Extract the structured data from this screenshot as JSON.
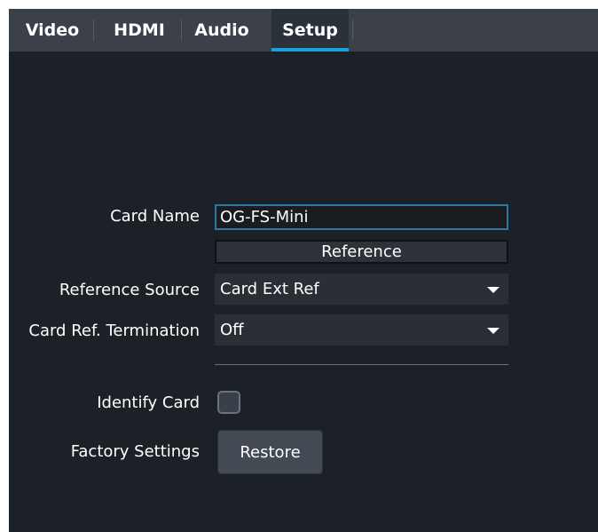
{
  "tabs": [
    {
      "label": "Video"
    },
    {
      "label": "HDMI"
    },
    {
      "label": "Audio"
    },
    {
      "label": "Setup",
      "active": true
    }
  ],
  "card_name": {
    "label": "Card Name",
    "value": "OG-FS-Mini"
  },
  "reference_section": {
    "title": "Reference"
  },
  "reference_source": {
    "label": "Reference Source",
    "selected": "Card Ext Ref"
  },
  "card_ref_termination": {
    "label": "Card Ref. Termination",
    "selected": "Off"
  },
  "identify_card": {
    "label": "Identify Card",
    "checked": false
  },
  "factory_settings": {
    "label": "Factory Settings",
    "button_label": "Restore"
  },
  "colors": {
    "panel_bg": "#1c2127",
    "tabbar_bg": "#3b4049",
    "active_tab_underline": "#1aa0d8",
    "input_border": "#2b78a8"
  }
}
